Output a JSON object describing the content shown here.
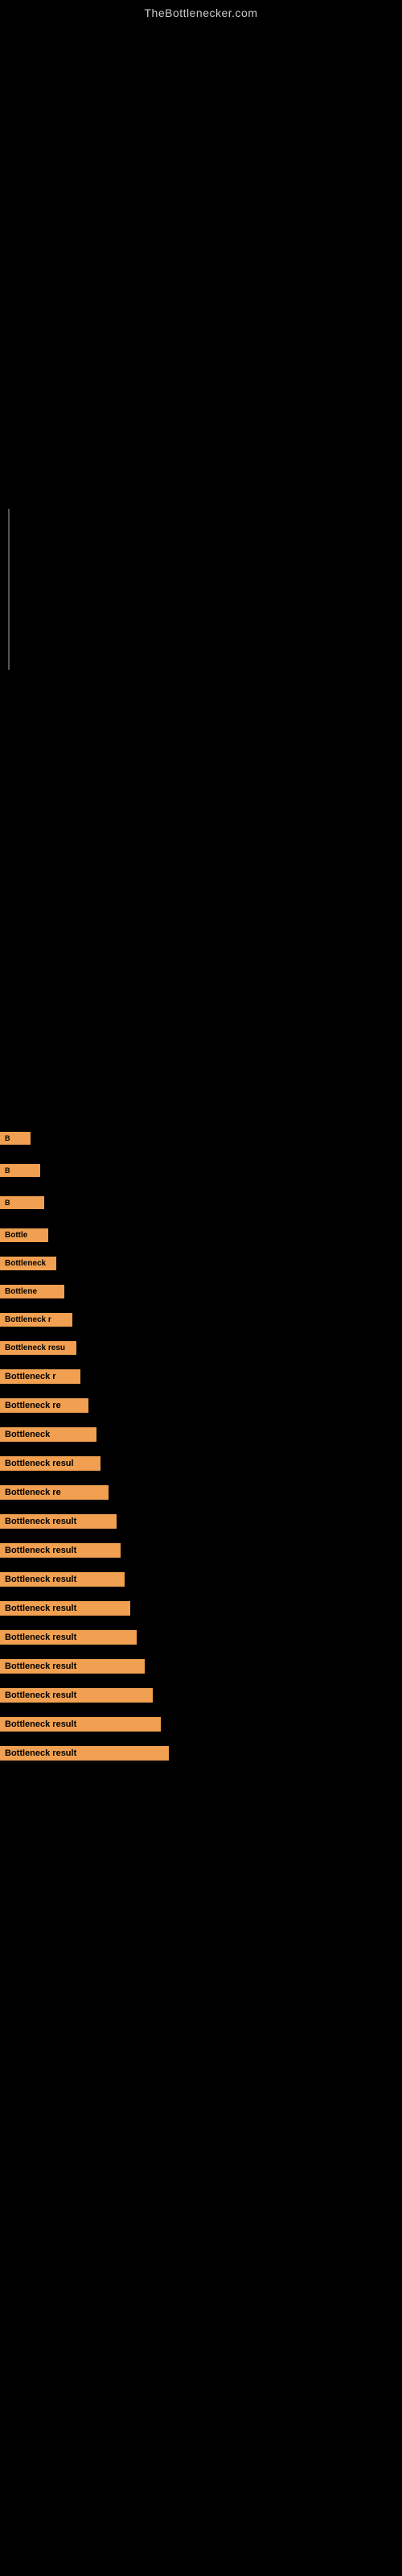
{
  "site": {
    "title": "TheBottlenecker.com"
  },
  "items": [
    {
      "label": "B",
      "width_class": "w-extra-small"
    },
    {
      "label": "B",
      "width_class": "w-small1"
    },
    {
      "label": "B",
      "width_class": "w-small2"
    },
    {
      "label": "Bottle",
      "width_class": "w-small3"
    },
    {
      "label": "Bottleneck",
      "width_class": "w-medium1"
    },
    {
      "label": "Bottlene",
      "width_class": "w-medium2"
    },
    {
      "label": "Bottleneck r",
      "width_class": "w-medium3"
    },
    {
      "label": "Bottleneck resu",
      "width_class": "w-medium4"
    },
    {
      "label": "Bottleneck r",
      "width_class": "w-large1"
    },
    {
      "label": "Bottleneck re",
      "width_class": "w-large2"
    },
    {
      "label": "Bottleneck",
      "width_class": "w-large3"
    },
    {
      "label": "Bottleneck resul",
      "width_class": "w-large4"
    },
    {
      "label": "Bottleneck re",
      "width_class": "w-xlarge1"
    },
    {
      "label": "Bottleneck result",
      "width_class": "w-xlarge2"
    },
    {
      "label": "Bottleneck result",
      "width_class": "w-xlarge3"
    },
    {
      "label": "Bottleneck result",
      "width_class": "w-xlarge4"
    },
    {
      "label": "Bottleneck result",
      "width_class": "w-xxlarge1"
    },
    {
      "label": "Bottleneck result",
      "width_class": "w-xxlarge2"
    },
    {
      "label": "Bottleneck result",
      "width_class": "w-xxlarge3"
    },
    {
      "label": "Bottleneck result",
      "width_class": "w-xxlarge4"
    },
    {
      "label": "Bottleneck result",
      "width_class": "w-xxxlarge1"
    },
    {
      "label": "Bottleneck result",
      "width_class": "w-xxxlarge2"
    }
  ]
}
